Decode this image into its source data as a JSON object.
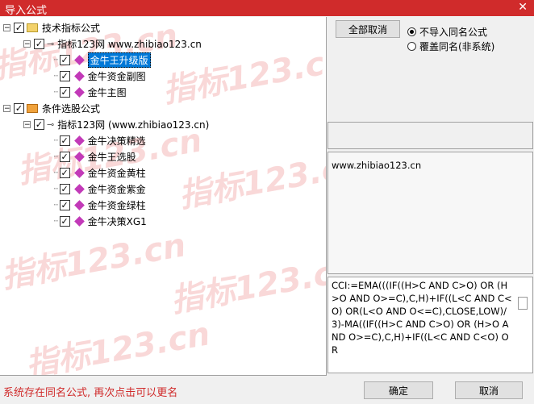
{
  "window": {
    "title": "导入公式",
    "close_glyph": "✕"
  },
  "tree": [
    {
      "label": "技术指标公式",
      "level": 0,
      "expander": "−",
      "checked": true,
      "icon": "folder-yellow",
      "selected": false
    },
    {
      "label": "指标123网 www.zhibiao123.cn",
      "level": 1,
      "expander": "−",
      "checked": true,
      "icon": "key",
      "selected": false
    },
    {
      "label": "金牛王升级版",
      "level": 2,
      "checked": true,
      "icon": "gem",
      "selected": true
    },
    {
      "label": "金牛资金副图",
      "level": 2,
      "checked": true,
      "icon": "gem",
      "selected": false
    },
    {
      "label": "金牛主图",
      "level": 2,
      "checked": true,
      "icon": "gem",
      "selected": false
    },
    {
      "label": "条件选股公式",
      "level": 0,
      "expander": "−",
      "checked": true,
      "icon": "folder-orange",
      "selected": false
    },
    {
      "label": "指标123网 (www.zhibiao123.cn)",
      "level": 1,
      "expander": "−",
      "checked": true,
      "icon": "key",
      "selected": false
    },
    {
      "label": "金牛决策精选",
      "level": 2,
      "checked": true,
      "icon": "gem",
      "selected": false
    },
    {
      "label": "金牛王选股",
      "level": 2,
      "checked": true,
      "icon": "gem",
      "selected": false
    },
    {
      "label": "金牛资金黄柱",
      "level": 2,
      "checked": true,
      "icon": "gem",
      "selected": false
    },
    {
      "label": "金牛资金紫金",
      "level": 2,
      "checked": true,
      "icon": "gem",
      "selected": false
    },
    {
      "label": "金牛资金绿柱",
      "level": 2,
      "checked": true,
      "icon": "gem",
      "selected": false
    },
    {
      "label": "金牛决策XG1",
      "level": 2,
      "checked": true,
      "icon": "gem",
      "selected": false
    }
  ],
  "side": {
    "cancel_all_label": "全部取消",
    "radio_skip_label": "不导入同名公式",
    "radio_overwrite_label": "覆盖同名(非系统)",
    "radio_selected": "skip",
    "desc_text": "www.zhibiao123.cn",
    "code_text": "CCI:=EMA(((IF((H>C AND C>O) OR (H>O AND O>=C),C,H)+IF((L<C AND C<O) OR(L<O AND O<=C),CLOSE,LOW)/3)-MA((IF((H>C AND C>O) OR (H>O AND O>=C),C,H)+IF((L<C AND C<O) OR"
  },
  "watermark": "指标123.cn",
  "footer": {
    "status_text": "系统存在同名公式, 再次点击可以更名",
    "ok_label": "确定",
    "cancel_label": "取消"
  },
  "colors": {
    "accent": "#d02b2b",
    "selection": "#0078d7",
    "gem": "#c23ab8"
  }
}
